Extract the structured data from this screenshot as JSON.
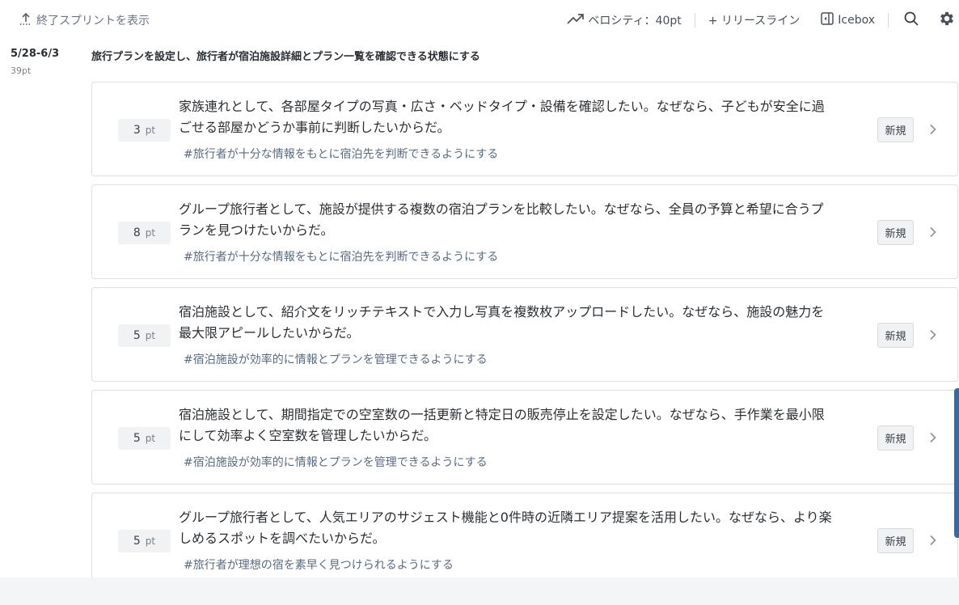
{
  "toolbar": {
    "show_ended_label": "終了スプリントを表示",
    "velocity_label": "ベロシティ：40pt",
    "release_line_label": "+ リリースライン",
    "icebox_label": "Icebox",
    "icons": [
      "upload-dotted-icon",
      "trend-up-icon",
      "icebox-panel-icon",
      "search-icon",
      "gear-icon",
      "chevron-right-icon"
    ]
  },
  "sprint": {
    "range": "5/28-6/3",
    "points": "39pt",
    "goal": "旅行プランを設定し、旅行者が宿泊施設詳細とプラン一覧を確認できる状態にする"
  },
  "stories": [
    {
      "points": "3",
      "unit": "pt",
      "title": "家族連れとして、各部屋タイプの写真・広さ・ベッドタイプ・設備を確認したい。なぜなら、子どもが安全に過ごせる部屋かどうか事前に判断したいからだ。",
      "tag": "#旅行者が十分な情報をもとに宿泊先を判断できるようにする",
      "status": "新規"
    },
    {
      "points": "8",
      "unit": "pt",
      "title": "グループ旅行者として、施設が提供する複数の宿泊プランを比較したい。なぜなら、全員の予算と希望に合うプランを見つけたいからだ。",
      "tag": "#旅行者が十分な情報をもとに宿泊先を判断できるようにする",
      "status": "新規"
    },
    {
      "points": "5",
      "unit": "pt",
      "title": "宿泊施設として、紹介文をリッチテキストで入力し写真を複数枚アップロードしたい。なぜなら、施設の魅力を最大限アピールしたいからだ。",
      "tag": "#宿泊施設が効率的に情報とプランを管理できるようにする",
      "status": "新規"
    },
    {
      "points": "5",
      "unit": "pt",
      "title": "宿泊施設として、期間指定での空室数の一括更新と特定日の販売停止を設定したい。なぜなら、手作業を最小限にして効率よく空室数を管理したいからだ。",
      "tag": "#宿泊施設が効率的に情報とプランを管理できるようにする",
      "status": "新規"
    },
    {
      "points": "5",
      "unit": "pt",
      "title": "グループ旅行者として、人気エリアのサジェスト機能と0件時の近隣エリア提案を活用したい。なぜなら、より楽しめるスポットを調べたいからだ。",
      "tag": "#旅行者が理想の宿を素早く見つけられるようにする",
      "status": "新規"
    }
  ]
}
